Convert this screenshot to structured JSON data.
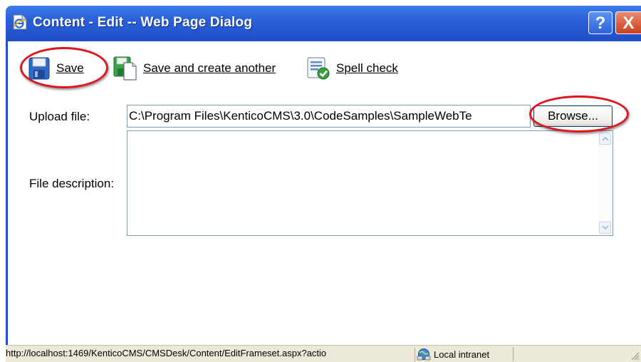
{
  "window": {
    "title": "Content - Edit -- Web Page Dialog",
    "help_label": "?",
    "close_label": "X"
  },
  "toolbar": {
    "save_label": "Save",
    "save_another_label": "Save and create another",
    "spell_check_label": "Spell check"
  },
  "form": {
    "upload_label": "Upload file:",
    "upload_value": "C:\\Program Files\\KenticoCMS\\3.0\\CodeSamples\\SampleWebTe",
    "browse_label": "Browse...",
    "description_label": "File description:",
    "description_value": ""
  },
  "status": {
    "url": "http://localhost:1469/KenticoCMS/CMSDesk/Content/EditFrameset.aspx?actio",
    "zone": "Local intranet"
  },
  "colors": {
    "titlebar": "#2a5fd8",
    "annotation_ring": "#e0141e",
    "statusbar": "#ece9d8"
  },
  "icons": {
    "title": "ie-page-icon",
    "save": "floppy-disk-icon",
    "save_another": "save-new-icon",
    "spell_check": "spell-check-icon",
    "zone": "local-intranet-icon"
  }
}
